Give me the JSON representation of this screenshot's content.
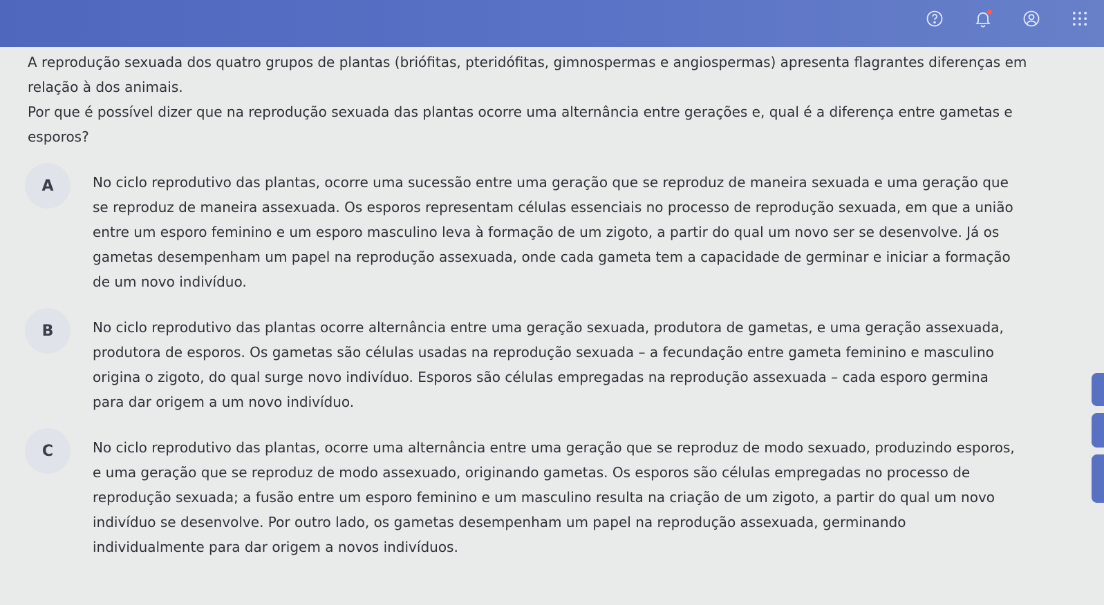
{
  "topbar": {
    "icons": [
      "help-icon",
      "notification-icon",
      "account-icon",
      "apps-grid-icon"
    ],
    "accent_color": "#5b73c6",
    "badge_color": "#ff5a4e"
  },
  "question": {
    "paragraph1": "A reprodução sexuada dos quatro grupos de plantas (briófitas, pteridófitas, gimnospermas e angiospermas) apresenta flagrantes diferenças em relação à dos animais.",
    "paragraph2": "Por que é possível dizer que na reprodução sexuada das plantas ocorre uma alternância entre gerações e, qual é a diferença entre gametas e esporos?"
  },
  "options": [
    {
      "letter": "A",
      "text": "No ciclo reprodutivo das plantas, ocorre uma sucessão entre uma geração que se reproduz de maneira sexuada e uma geração que se reproduz de maneira assexuada. Os esporos representam células essenciais no processo de reprodução sexuada, em que a união entre um esporo feminino e um esporo masculino leva à formação de um zigoto, a partir do qual um novo ser se desenvolve. Já os gametas desempenham um papel na reprodução assexuada, onde cada gameta tem a capacidade de germinar e iniciar a formação de um novo indivíduo."
    },
    {
      "letter": "B",
      "text": "No ciclo reprodutivo das plantas ocorre alternância entre uma geração sexuada, produtora de gametas, e uma geração assexuada, produtora de esporos. Os gametas são células usadas na reprodução sexuada – a fecundação entre gameta feminino e masculino origina o zigoto, do qual surge novo indivíduo. Esporos são células empregadas na reprodução assexuada – cada esporo germina para dar origem a um novo indivíduo."
    },
    {
      "letter": "C",
      "text": "No ciclo reprodutivo das plantas, ocorre uma alternância entre uma geração que se reproduz de modo sexuado, produzindo esporos, e uma geração que se reproduz de modo assexuado, originando gametas. Os esporos são células empregadas no processo de reprodução sexuada; a fusão entre um esporo feminino e um masculino resulta na criação de um zigoto, a partir do qual um novo indivíduo se desenvolve. Por outro lado, os gametas desempenham um papel na reprodução assexuada, germinando individualmente para dar origem a novos indivíduos."
    }
  ]
}
